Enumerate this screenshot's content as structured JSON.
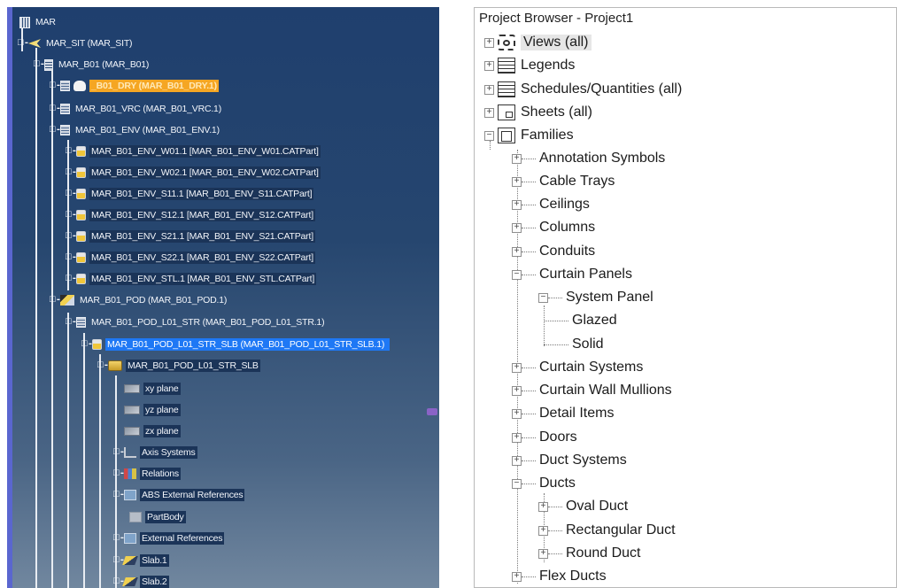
{
  "catia": {
    "tree": [
      {
        "label": "MAR",
        "icon": "assembly-icon",
        "style": "plain"
      },
      {
        "label": "MAR_SIT (MAR_SIT)",
        "icon": "site-icon",
        "style": "plain"
      },
      {
        "label": "MAR_B01 (MAR_B01)",
        "icon": "building-icon",
        "style": "plain"
      },
      {
        "label": "_B01_DRY (MAR_B01_DRY.1)",
        "icon": "hand-icon",
        "style": "orange"
      },
      {
        "label": "MAR_B01_VRC (MAR_B01_VRC.1)",
        "icon": "product-icon",
        "style": "plain"
      },
      {
        "label": "MAR_B01_ENV (MAR_B01_ENV.1)",
        "icon": "product-icon",
        "style": "plain"
      },
      {
        "label": "MAR_B01_ENV_W01.1 [MAR_B01_ENV_W01.CATPart]",
        "icon": "part-icon",
        "style": "box"
      },
      {
        "label": "MAR_B01_ENV_W02.1 [MAR_B01_ENV_W02.CATPart]",
        "icon": "part-icon",
        "style": "box"
      },
      {
        "label": "MAR_B01_ENV_S11.1 [MAR_B01_ENV_S11.CATPart]",
        "icon": "part-icon",
        "style": "box"
      },
      {
        "label": "MAR_B01_ENV_S12.1 [MAR_B01_ENV_S12.CATPart]",
        "icon": "part-icon",
        "style": "box"
      },
      {
        "label": "MAR_B01_ENV_S21.1 [MAR_B01_ENV_S21.CATPart]",
        "icon": "part-icon",
        "style": "box"
      },
      {
        "label": "MAR_B01_ENV_S22.1 [MAR_B01_ENV_S22.CATPart]",
        "icon": "part-icon",
        "style": "box"
      },
      {
        "label": "MAR_B01_ENV_STL.1 [MAR_B01_ENV_STL.CATPart]",
        "icon": "part-icon",
        "style": "box"
      },
      {
        "label": "MAR_B01_POD (MAR_B01_POD.1)",
        "icon": "pod-icon",
        "style": "plain"
      },
      {
        "label": "MAR_B01_POD_L01_STR (MAR_B01_POD_L01_STR.1)",
        "icon": "product-icon",
        "style": "plain"
      },
      {
        "label": "MAR_B01_POD_L01_STR_SLB (MAR_B01_POD_L01_STR_SLB.1)",
        "icon": "part-icon",
        "style": "blue"
      },
      {
        "label": "MAR_B01_POD_L01_STR_SLB",
        "icon": "part-folder-icon",
        "style": "box"
      },
      {
        "label": "xy plane",
        "icon": "plane-icon",
        "style": "box"
      },
      {
        "label": "yz plane",
        "icon": "plane-icon",
        "style": "box"
      },
      {
        "label": "zx plane",
        "icon": "plane-icon",
        "style": "box"
      },
      {
        "label": "Axis Systems",
        "icon": "axis-icon",
        "style": "box"
      },
      {
        "label": "Relations",
        "icon": "relations-icon",
        "style": "box"
      },
      {
        "label": "ABS External References",
        "icon": "external-ref-icon",
        "style": "box"
      },
      {
        "label": "PartBody",
        "icon": "body-icon",
        "style": "box"
      },
      {
        "label": "External References",
        "icon": "external-ref-icon",
        "style": "box"
      },
      {
        "label": "Slab.1",
        "icon": "slab-icon",
        "style": "box"
      },
      {
        "label": "Slab.2",
        "icon": "slab-icon",
        "style": "box"
      }
    ]
  },
  "browser": {
    "title": "Project Browser - Project1",
    "items": [
      {
        "label": "Views (all)",
        "toggle": "+",
        "icon": "views-icon",
        "selected": true
      },
      {
        "label": "Legends",
        "toggle": "+",
        "icon": "legends-icon"
      },
      {
        "label": "Schedules/Quantities (all)",
        "toggle": "+",
        "icon": "schedules-icon"
      },
      {
        "label": "Sheets (all)",
        "toggle": "+",
        "icon": "sheets-icon"
      },
      {
        "label": "Families",
        "toggle": "−",
        "icon": "families-icon"
      },
      {
        "label": "Annotation Symbols",
        "toggle": "+"
      },
      {
        "label": "Cable Trays",
        "toggle": "+"
      },
      {
        "label": "Ceilings",
        "toggle": "+"
      },
      {
        "label": "Columns",
        "toggle": "+"
      },
      {
        "label": "Conduits",
        "toggle": "+"
      },
      {
        "label": "Curtain Panels",
        "toggle": "−"
      },
      {
        "label": "System Panel",
        "toggle": "−"
      },
      {
        "label": "Glazed",
        "toggle": ""
      },
      {
        "label": "Solid",
        "toggle": ""
      },
      {
        "label": "Curtain Systems",
        "toggle": "+"
      },
      {
        "label": "Curtain Wall Mullions",
        "toggle": "+"
      },
      {
        "label": "Detail Items",
        "toggle": "+"
      },
      {
        "label": "Doors",
        "toggle": "+"
      },
      {
        "label": "Duct Systems",
        "toggle": "+"
      },
      {
        "label": "Ducts",
        "toggle": "−"
      },
      {
        "label": "Oval Duct",
        "toggle": "+"
      },
      {
        "label": "Rectangular Duct",
        "toggle": "+"
      },
      {
        "label": "Round Duct",
        "toggle": "+"
      },
      {
        "label": "Flex Ducts",
        "toggle": "+"
      }
    ]
  }
}
